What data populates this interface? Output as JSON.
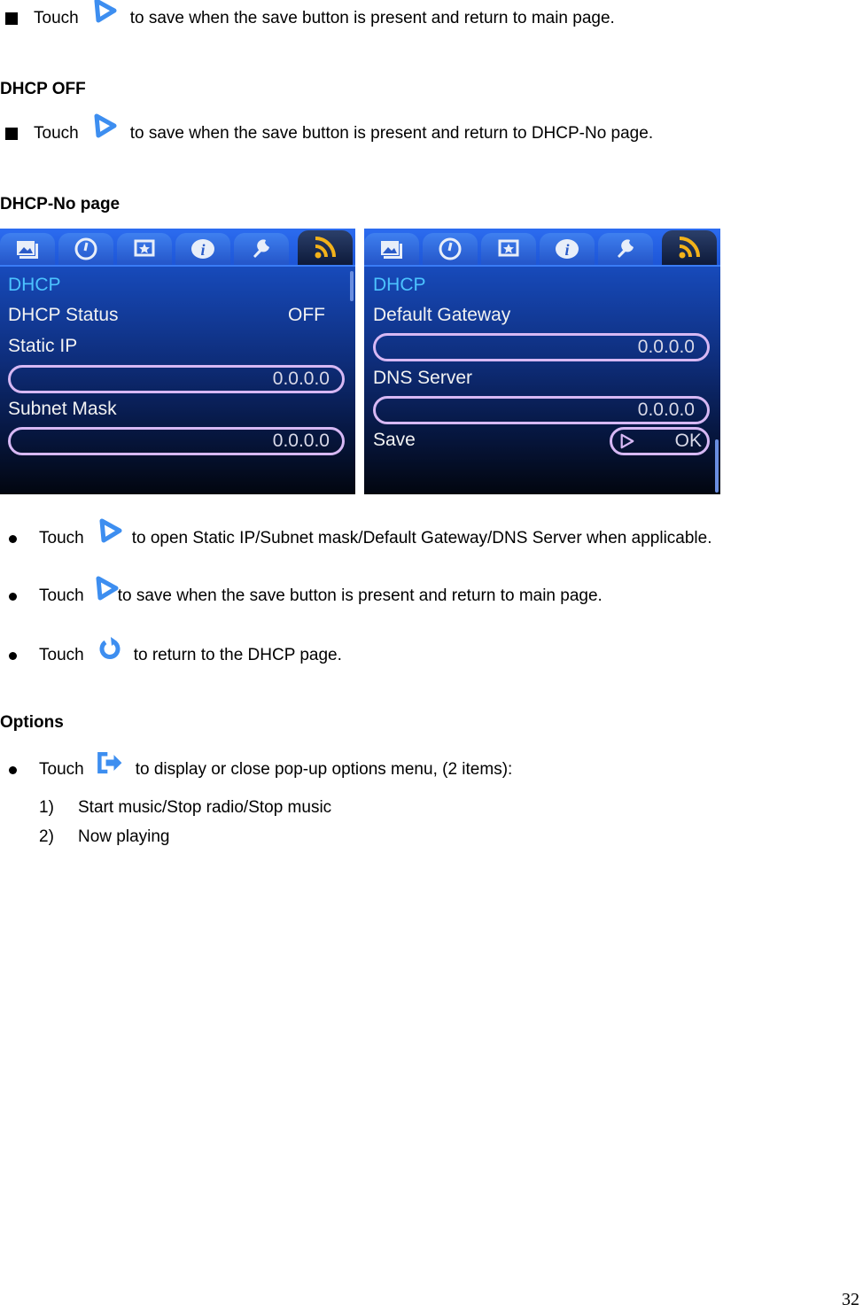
{
  "intro": {
    "touch_label": "Touch",
    "save_main_text": "to save when the save button is present and return to main page."
  },
  "dhcp_off": {
    "heading": "DHCP OFF",
    "touch_label": "Touch",
    "text": "to save when the save button is present and return to DHCP-No page."
  },
  "dhcp_no_page": {
    "heading": "DHCP-No page",
    "screen1": {
      "tabs": [
        "photo-icon",
        "clock-icon",
        "favorites-icon",
        "info-icon",
        "settings-wrench-icon",
        "rss-network-icon"
      ],
      "active_tab": 5,
      "title": "DHCP",
      "status_label": "DHCP Status",
      "status_value": "OFF",
      "static_ip_label": "Static IP",
      "static_ip_value": "0.0.0.0",
      "subnet_label": "Subnet Mask",
      "subnet_value": "0.0.0.0"
    },
    "screen2": {
      "tabs": [
        "photo-icon",
        "clock-icon",
        "favorites-icon",
        "info-icon",
        "settings-wrench-icon",
        "rss-network-icon"
      ],
      "active_tab": 5,
      "title": "DHCP",
      "gateway_label": "Default Gateway",
      "gateway_value": "0.0.0.0",
      "dns_label": "DNS Server",
      "dns_value": "0.0.0.0",
      "save_label": "Save",
      "ok_label": "OK"
    },
    "bullets": [
      {
        "touch": "Touch",
        "icon": "play-arrow-icon",
        "text": "to open Static IP/Subnet mask/Default Gateway/DNS Server when applicable."
      },
      {
        "touch": "Touch",
        "icon": "play-arrow-icon",
        "text": "to save when the save button is present and return to main page."
      },
      {
        "touch": "Touch",
        "icon": "return-icon",
        "text": "to return to the DHCP page."
      }
    ]
  },
  "options": {
    "heading": "Options",
    "touch": "Touch",
    "icon": "options-arrow-icon",
    "text": "to display or close pop-up options menu, (2 items):",
    "items": [
      {
        "num": "1)",
        "label": "Start music/Stop radio/Stop music"
      },
      {
        "num": "2)",
        "label": "Now playing"
      }
    ]
  },
  "colors": {
    "icon_blue": "#3d8ef0",
    "screen_title": "#4cc3ff",
    "pill_border": "#d7b8f4",
    "rss_orange": "#f3b21a"
  },
  "page_number": "32"
}
